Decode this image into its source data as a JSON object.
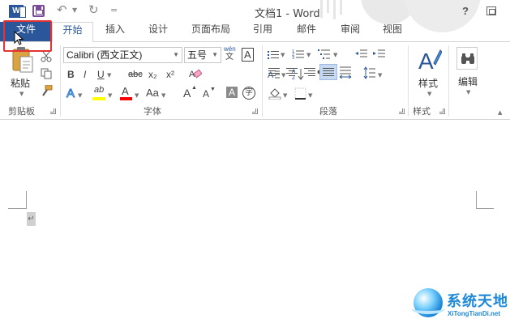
{
  "window": {
    "title": "文档1 - Word",
    "help_label": "?",
    "app_icon_letter": "W"
  },
  "quick_access": {
    "undo_glyph": "↶",
    "redo_glyph": "↻",
    "customize_glyph": "="
  },
  "tabs": [
    {
      "label": "文件"
    },
    {
      "label": "开始"
    },
    {
      "label": "插入"
    },
    {
      "label": "设计"
    },
    {
      "label": "页面布局"
    },
    {
      "label": "引用"
    },
    {
      "label": "邮件"
    },
    {
      "label": "审阅"
    },
    {
      "label": "视图"
    }
  ],
  "ribbon": {
    "clipboard": {
      "paste_label": "粘贴",
      "group_label": "剪贴板"
    },
    "font": {
      "font_name": "Calibri (西文正文)",
      "font_size": "五号",
      "wen_glyph": "wén",
      "a_box_glyph": "A",
      "bold": "B",
      "italic": "I",
      "underline": "U",
      "strikethrough": "abc",
      "subscript": "x₂",
      "superscript": "x²",
      "text_effects": "A",
      "highlight": "ab",
      "font_color": "A",
      "change_case": "Aa",
      "grow": "A",
      "shrink": "A",
      "char_shading": "A",
      "enclose": "字",
      "group_label": "字体"
    },
    "paragraph": {
      "group_label": "段落"
    },
    "styles": {
      "styles_label": "样式",
      "group_label": "样式"
    },
    "editing": {
      "editing_label": "编辑"
    }
  },
  "document": {
    "paragraph_mark": "↵"
  },
  "watermark": {
    "brand_text": "系统天地",
    "brand_url": "XiTongTianDi.net"
  },
  "colors": {
    "word_blue": "#2b579a",
    "highlight_red": "#e53333",
    "highlight_yellow": "#ffff00",
    "font_color_red": "#ff0000",
    "selected_align": "#c5d9f1"
  }
}
